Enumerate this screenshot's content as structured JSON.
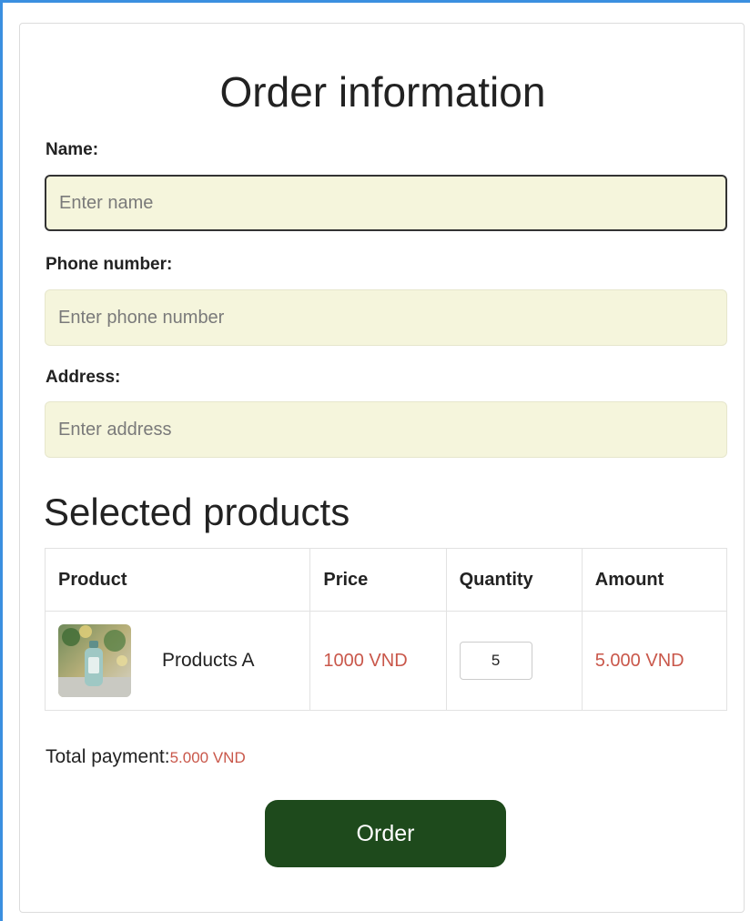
{
  "form": {
    "title": "Order information",
    "name": {
      "label": "Name:",
      "placeholder": "Enter name",
      "value": ""
    },
    "phone": {
      "label": "Phone number:",
      "placeholder": "Enter phone number",
      "value": ""
    },
    "address": {
      "label": "Address:",
      "placeholder": "Enter address",
      "value": ""
    }
  },
  "products": {
    "title": "Selected products",
    "columns": [
      "Product",
      "Price",
      "Quantity",
      "Amount"
    ],
    "rows": [
      {
        "name": "Products A",
        "price": "1000 VND",
        "quantity": "5",
        "amount": "5.000 VND"
      }
    ]
  },
  "total": {
    "label": "Total payment:",
    "value": "5.000 VND"
  },
  "order_button": "Order",
  "colors": {
    "accent_price": "#c9574a",
    "button_bg": "#1e4a1c",
    "field_bg": "#f5f5dc",
    "frame_border": "#3b8fe0"
  }
}
